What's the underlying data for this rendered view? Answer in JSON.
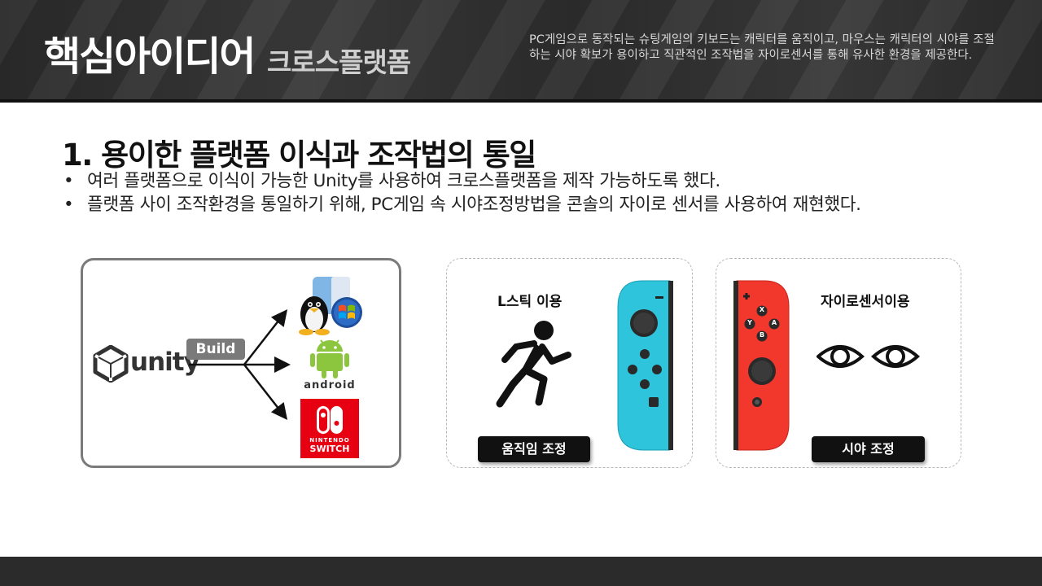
{
  "header": {
    "title_main": "핵심아이디어",
    "title_sub": "크로스플랫폼",
    "description": "PC게임으로 동작되는 슈팅게임의 키보드는 캐릭터를 움직이고, 마우스는 캐릭터의 시야를 조절하는 시야 확보가 용이하고 직관적인 조작법을 자이로센서를 통해 유사한 환경을 제공한다."
  },
  "section": {
    "title": "1. 용이한 플랫폼 이식과 조작법의 통일",
    "bullets": [
      "여러 플랫폼으로 이식이 가능한 Unity를 사용하여 크로스플랫폼을 제작 가능하도록 했다.",
      "플랫폼 사이 조작환경을 통일하기 위해, PC게임 속 시야조정방법을 콘솔의 자이로 센서를 사용하여 재현했다."
    ]
  },
  "build_panel": {
    "engine": "unity",
    "build_label": "Build",
    "android_label": "android",
    "switch_line1": "NINTENDO",
    "switch_line2": "SWITCH"
  },
  "move_panel": {
    "heading": "L스틱 이용",
    "pill": "움직임 조정"
  },
  "view_panel": {
    "heading": "자이로센서이용",
    "pill": "시야 조정",
    "buttons": [
      "X",
      "Y",
      "A",
      "B"
    ]
  },
  "colors": {
    "joycon_blue": "#2ec4dc",
    "joycon_red": "#f2372d",
    "switch_red": "#e60012",
    "badge_gray": "#7a7a7a"
  }
}
